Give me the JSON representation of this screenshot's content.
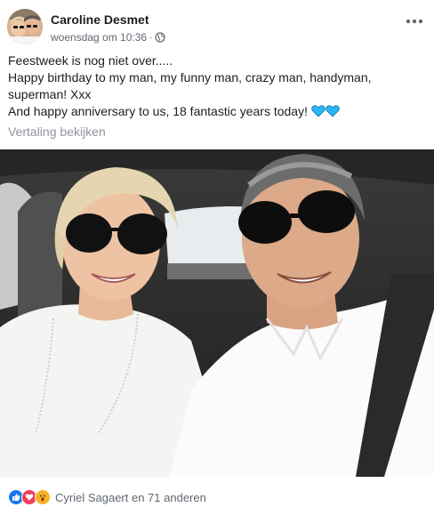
{
  "post": {
    "author": "Caroline Desmet",
    "timestamp": "woensdag om 10:36",
    "separator": "·",
    "privacy_icon": "globe-icon",
    "menu_icon": "more-horizontal-icon",
    "text_lines": [
      "Feestweek is nog niet over.....",
      "Happy birthday to my man, my funny man, crazy man, handyman, superman! Xxx",
      "And happy anniversary to us, 18 fantastic years today!"
    ],
    "trailing_emojis": [
      "blue-heart-icon",
      "blue-heart-icon"
    ],
    "translate_link": "Vertaling bekijken"
  },
  "reactions": {
    "icons": [
      "like-icon",
      "love-icon",
      "wow-icon"
    ],
    "summary": "Cyriel Sagaert en 71 anderen"
  },
  "colors": {
    "text": "#1c1e21",
    "meta": "#606770",
    "link_grey": "#90949c",
    "like_blue": "#1877f2",
    "love_red": "#f33e58",
    "wow_yellow": "#f7b125",
    "heart_blue": "#29b6f6"
  }
}
